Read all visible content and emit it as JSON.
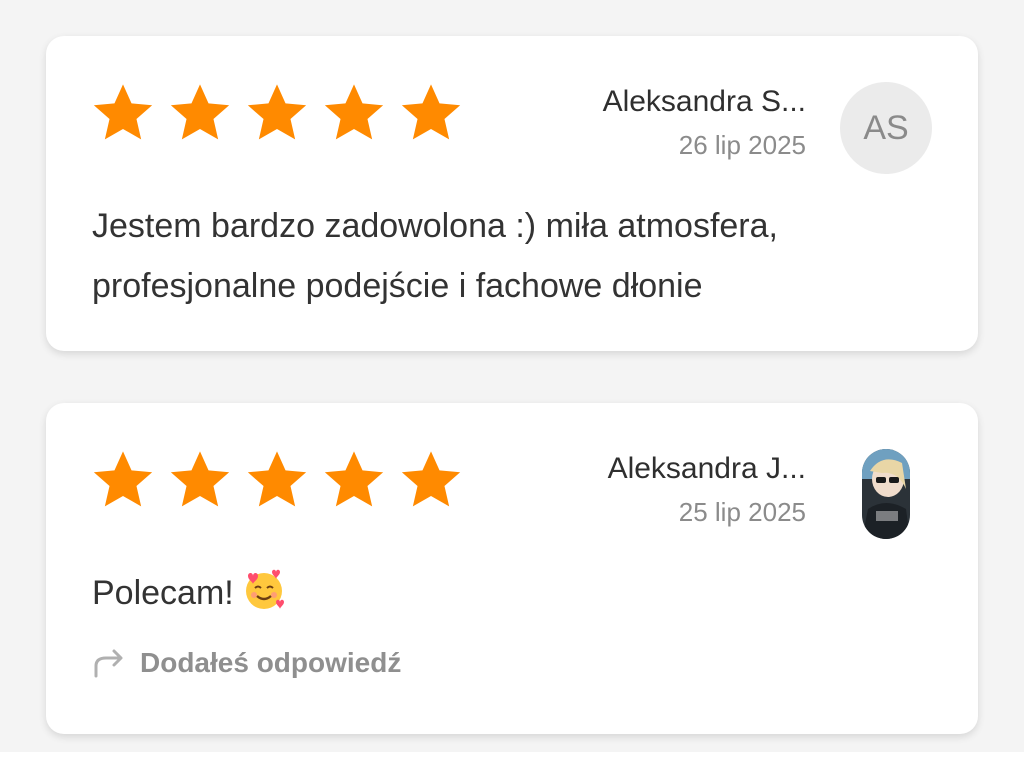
{
  "reviews": [
    {
      "rating": 5,
      "author_name": "Aleksandra S...",
      "date": "26 lip 2025",
      "avatar_initials": "AS",
      "text": "Jestem bardzo zadowolona :) miła atmosfera, profesjonalne podejście i fachowe dłonie",
      "reply_label": null
    },
    {
      "rating": 5,
      "author_name": "Aleksandra J...",
      "date": "25 lip 2025",
      "avatar_initials": null,
      "text": "Polecam!",
      "emoji": "smiling-face-with-hearts-emoji",
      "reply_label": "Dodałeś odpowiedź",
      "reply_icon": "reply-arrow-icon"
    }
  ],
  "colors": {
    "star": "#FF8A00",
    "text": "#333333",
    "muted": "#8B8B8B",
    "avatar_bg": "#EBEBEB"
  }
}
